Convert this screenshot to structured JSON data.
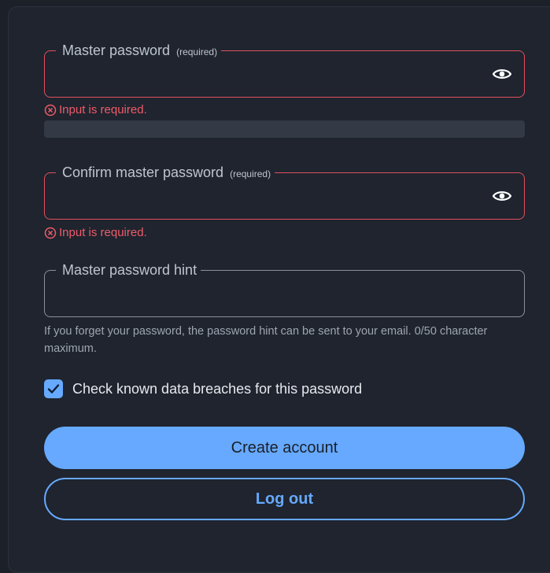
{
  "colors": {
    "accent": "#66a9ff",
    "error": "#ef5b6a",
    "background": "#1f242e"
  },
  "master_password": {
    "label": "Master password",
    "required": "(required)",
    "error": "Input is required.",
    "toggle_icon": "eye-icon"
  },
  "confirm_password": {
    "label": "Confirm master password",
    "required": "(required)",
    "error": "Input is required.",
    "toggle_icon": "eye-icon"
  },
  "hint_field": {
    "label": "Master password hint",
    "help": "If you forget your password, the password hint can be sent to your email. 0/50 character maximum."
  },
  "breach_check": {
    "label": "Check known data breaches for this password",
    "checked": true
  },
  "buttons": {
    "create": "Create account",
    "logout": "Log out"
  }
}
